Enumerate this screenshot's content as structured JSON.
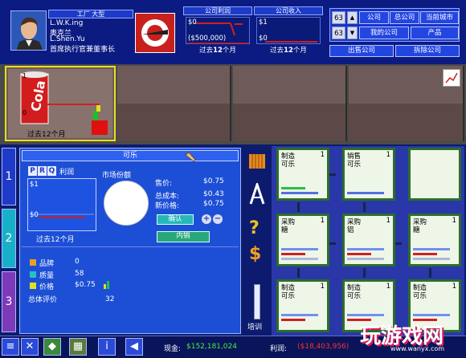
{
  "header": {
    "company_title": "工厂   大型",
    "player_name": "L.W.K.ing",
    "player_cn": "奥克兰",
    "deputy_name": "L.Shen.Yu",
    "role": "首席执行官兼董事长"
  },
  "profit_box": {
    "title": "公司利润",
    "top_value": "$0",
    "bottom_value": "($500,000)",
    "caption_prefix": "过去",
    "caption_num": "12",
    "caption_suffix": "个月"
  },
  "income_box": {
    "title": "公司收入",
    "top_value": "$1",
    "bottom_value": "$0",
    "caption_prefix": "过去",
    "caption_num": "12",
    "caption_suffix": "个月"
  },
  "nav": {
    "num1": "63",
    "num2": "63",
    "btn_company": "公司",
    "btn_head_company": "总公司",
    "btn_current_city": "当前城市",
    "btn_my_company": "我的公司",
    "btn_product": "产品",
    "btn_sell_company": "出售公司",
    "btn_dismantle_company": "拆除公司"
  },
  "view": {
    "slot1_value": "1",
    "slot1_zero": "0",
    "slot1_caption": "过去12个月",
    "product_can_text": "Cola"
  },
  "side_tabs": [
    "1",
    "2",
    "3"
  ],
  "product_panel": {
    "title": "可乐",
    "tab_p": "P",
    "tab_r": "R",
    "tab_q": "Q",
    "tab_label": "利润",
    "chart_top": "$1",
    "chart_bottom": "$0",
    "chart_caption": "过去12个月",
    "market_share_label": "市场份额",
    "price_label": "售价:",
    "price_value": "$0.75",
    "total_cost_label": "总成本:",
    "total_cost_value": "$0.43",
    "new_price_label": "新价格:",
    "new_price_value": "$0.75",
    "confirm_button": "确认",
    "plus_label": "+",
    "minus_label": "−",
    "domestic_button": "内销",
    "attributes": [
      {
        "label": "品牌",
        "value": "0",
        "color": "#e8a020"
      },
      {
        "label": "质量",
        "value": "58",
        "color": "#28c0c0"
      },
      {
        "label": "价格",
        "value": "$0.75",
        "color": "#e0e020"
      }
    ],
    "overall_label": "总体评价",
    "overall_value": "32"
  },
  "tools": {
    "question_icon": "?",
    "dollar_icon": "$",
    "training_label": "培训"
  },
  "grid_cells": [
    {
      "type": "制造",
      "num": "1",
      "product": "可乐"
    },
    {
      "type": "销售",
      "num": "1",
      "product": "可乐"
    },
    {
      "type": "",
      "num": "",
      "product": ""
    },
    {
      "type": "",
      "num": "",
      "product": ""
    },
    {
      "type": "采购",
      "num": "1",
      "product": "糖"
    },
    {
      "type": "采购",
      "num": "1",
      "product": "铝"
    },
    {
      "type": "采购",
      "num": "1",
      "product": "糖"
    },
    {
      "type": "",
      "num": "",
      "product": ""
    },
    {
      "type": "制造",
      "num": "1",
      "product": "可乐"
    },
    {
      "type": "制造",
      "num": "1",
      "product": "可乐"
    },
    {
      "type": "制造",
      "num": "1",
      "product": "可乐"
    },
    {
      "type": "",
      "num": "",
      "product": ""
    }
  ],
  "bottom": {
    "cash_label": "现金:",
    "cash_value": "$152,181,024",
    "profit_label": "利润:",
    "profit_value": "($18,403,956)",
    "watermark": "玩游戏网",
    "watermark_url": "www.wanyx.com"
  },
  "colors": {
    "background": "#0d1b6e",
    "panel_blue": "#1d4fd6",
    "red_line": "#d02020",
    "cash_green": "#3ef03e",
    "profit_red": "#ff3030",
    "selected_outline": "#e8e020"
  }
}
